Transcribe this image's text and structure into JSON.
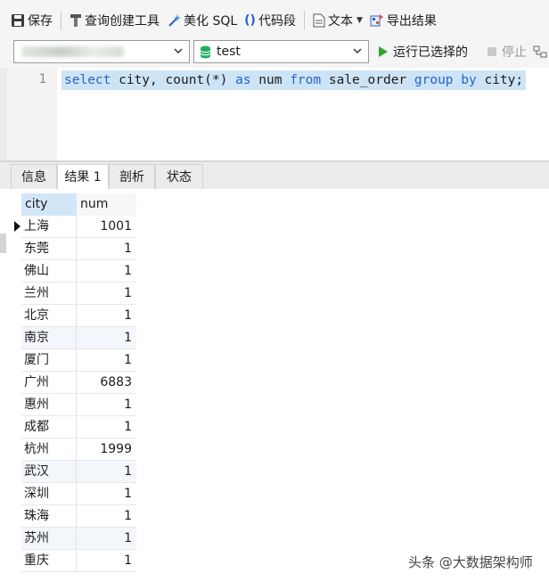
{
  "toolbar": {
    "save": "保存",
    "query_builder": "查询创建工具",
    "beautify": "美化 SQL",
    "snippet": "代码段",
    "text": "文本",
    "export": "导出结果"
  },
  "selectors": {
    "database": "test",
    "run_selected": "运行已选择的",
    "stop": "停止"
  },
  "editor": {
    "line_number": "1",
    "sql": [
      {
        "t": "select",
        "k": true
      },
      {
        "t": " city, count(*) ",
        "k": false
      },
      {
        "t": "as",
        "k": true
      },
      {
        "t": " num ",
        "k": false
      },
      {
        "t": "from",
        "k": true
      },
      {
        "t": " sale_order ",
        "k": false
      },
      {
        "t": "group",
        "k": true
      },
      {
        "t": " ",
        "k": false
      },
      {
        "t": "by",
        "k": true
      },
      {
        "t": " city;",
        "k": false
      }
    ]
  },
  "tabs": [
    "信息",
    "结果 1",
    "剖析",
    "状态"
  ],
  "active_tab": 1,
  "grid": {
    "columns": [
      "city",
      "num"
    ],
    "rows": [
      [
        "上海",
        "1001"
      ],
      [
        "东莞",
        "1"
      ],
      [
        "佛山",
        "1"
      ],
      [
        "兰州",
        "1"
      ],
      [
        "北京",
        "1"
      ],
      [
        "南京",
        "1"
      ],
      [
        "厦门",
        "1"
      ],
      [
        "广州",
        "6883"
      ],
      [
        "惠州",
        "1"
      ],
      [
        "成都",
        "1"
      ],
      [
        "杭州",
        "1999"
      ],
      [
        "武汉",
        "1"
      ],
      [
        "深圳",
        "1"
      ],
      [
        "珠海",
        "1"
      ],
      [
        "苏州",
        "1"
      ],
      [
        "重庆",
        "1"
      ]
    ]
  },
  "watermark": "头条 @大数据架构师",
  "colors": {
    "keyword": "#2a62c8",
    "selection": "#cde4f7",
    "run_green": "#2fa52f",
    "db_green": "#27ae60"
  }
}
